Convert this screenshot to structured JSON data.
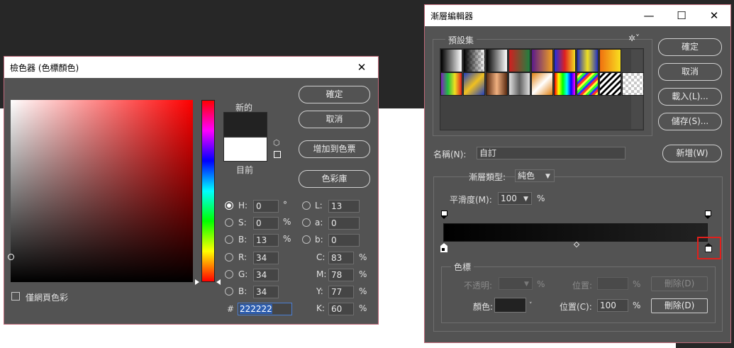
{
  "color_picker": {
    "title": "檢色器 (色標顏色)",
    "new_label": "新的",
    "current_label": "目前",
    "new_color": "#222222",
    "current_color": "#ffffff",
    "buttons": {
      "ok": "確定",
      "cancel": "取消",
      "add_swatch": "增加到色票",
      "color_library": "色彩庫"
    },
    "hsb": [
      {
        "label": "H:",
        "value": "0",
        "unit": "°",
        "selected": true
      },
      {
        "label": "S:",
        "value": "0",
        "unit": "%",
        "selected": false
      },
      {
        "label": "B:",
        "value": "13",
        "unit": "%",
        "selected": false
      }
    ],
    "lab": [
      {
        "label": "L:",
        "value": "13"
      },
      {
        "label": "a:",
        "value": "0"
      },
      {
        "label": "b:",
        "value": "0"
      }
    ],
    "rgb": [
      {
        "label": "R:",
        "value": "34"
      },
      {
        "label": "G:",
        "value": "34"
      },
      {
        "label": "B:",
        "value": "34"
      }
    ],
    "cmyk": [
      {
        "label": "C:",
        "value": "83",
        "unit": "%"
      },
      {
        "label": "M:",
        "value": "78",
        "unit": "%"
      },
      {
        "label": "Y:",
        "value": "77",
        "unit": "%"
      },
      {
        "label": "K:",
        "value": "60",
        "unit": "%"
      }
    ],
    "hex_label": "#",
    "hex_value": "222222",
    "web_only_label": "僅網頁色彩"
  },
  "gradient_editor": {
    "title": "漸層編輯器",
    "presets_label": "預設集",
    "buttons": {
      "ok": "確定",
      "cancel": "取消",
      "load": "載入(L)...",
      "save": "儲存(S)...",
      "new": "新增(W)"
    },
    "name_label": "名稱(N):",
    "name_value": "自訂",
    "gradient_type_label": "漸層類型:",
    "gradient_type_value": "純色",
    "smoothness_label": "平滑度(M):",
    "smoothness_value": "100",
    "smoothness_unit": "%",
    "stops_group_label": "色標",
    "opacity_label": "不透明:",
    "opacity_value": "",
    "opacity_unit": "%",
    "opacity_location_label": "位置:",
    "opacity_location_value": "",
    "opacity_location_unit": "%",
    "opacity_delete": "刪除(D)",
    "color_label": "顏色:",
    "stop_color": "#222222",
    "color_location_label": "位置(C):",
    "color_location_value": "100",
    "color_location_unit": "%",
    "color_delete": "刪除(D)"
  }
}
